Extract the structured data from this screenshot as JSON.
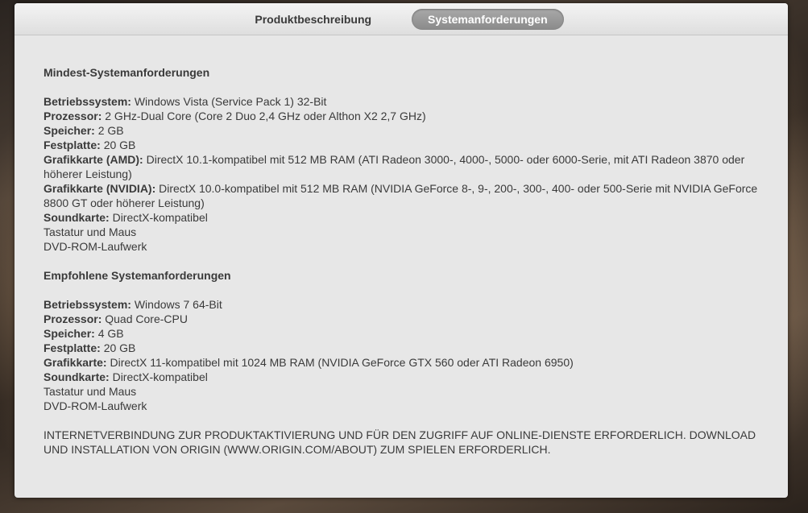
{
  "tabs": [
    {
      "label": "Produktbeschreibung",
      "active": false
    },
    {
      "label": "Systemanforderungen",
      "active": true
    }
  ],
  "minimum": {
    "title": "Mindest-Systemanforderungen",
    "specs": [
      {
        "label": "Betriebssystem:",
        "value": "Windows Vista (Service Pack 1) 32-Bit"
      },
      {
        "label": "Prozessor:",
        "value": "2 GHz-Dual Core (Core 2 Duo 2,4 GHz oder Althon X2 2,7 GHz)"
      },
      {
        "label": "Speicher:",
        "value": "2 GB"
      },
      {
        "label": "Festplatte:",
        "value": "20 GB"
      },
      {
        "label": "Grafikkarte (AMD):",
        "value": "DirectX 10.1-kompatibel mit 512 MB RAM (ATI Radeon 3000-, 4000-, 5000- oder 6000-Serie, mit ATI Radeon 3870 oder höherer Leistung)"
      },
      {
        "label": "Grafikkarte (NVIDIA):",
        "value": "DirectX 10.0-kompatibel mit 512 MB RAM (NVIDIA GeForce 8-, 9-, 200-, 300-, 400- oder 500-Serie mit NVIDIA GeForce 8800 GT oder höherer Leistung)"
      },
      {
        "label": "Soundkarte:",
        "value": "DirectX-kompatibel"
      }
    ],
    "extras": [
      "Tastatur und Maus",
      "DVD-ROM-Laufwerk"
    ]
  },
  "recommended": {
    "title": "Empfohlene Systemanforderungen",
    "specs": [
      {
        "label": "Betriebssystem:",
        "value": "Windows 7 64-Bit"
      },
      {
        "label": "Prozessor:",
        "value": "Quad Core-CPU"
      },
      {
        "label": "Speicher:",
        "value": "4 GB"
      },
      {
        "label": "Festplatte:",
        "value": "20 GB"
      },
      {
        "label": "Grafikkarte:",
        "value": "DirectX 11-kompatibel mit 1024 MB RAM (NVIDIA GeForce GTX 560 oder ATI Radeon 6950)"
      },
      {
        "label": "Soundkarte:",
        "value": "DirectX-kompatibel"
      }
    ],
    "extras": [
      "Tastatur und Maus",
      "DVD-ROM-Laufwerk"
    ]
  },
  "notice": "INTERNETVERBINDUNG ZUR PRODUKTAKTIVIERUNG UND FÜR DEN ZUGRIFF AUF ONLINE-DIENSTE ERFORDERLICH. DOWNLOAD UND INSTALLATION VON ORIGIN (WWW.ORIGIN.COM/ABOUT) ZUM SPIELEN ERFORDERLICH.",
  "colors": {
    "panel_bg": "#e7e7e7",
    "text": "#3a3a3a",
    "active_tab_bg": "#999999",
    "active_tab_text": "#ffffff"
  }
}
